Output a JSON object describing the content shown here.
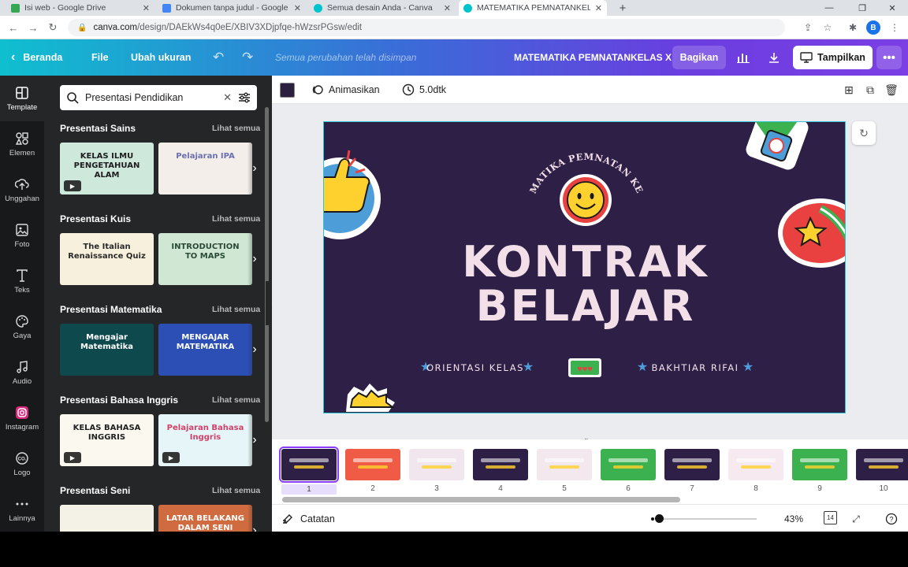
{
  "browser": {
    "tabs": [
      {
        "title": "Isi web - Google Drive",
        "color": "#34a853"
      },
      {
        "title": "Dokumen tanpa judul - Google D",
        "color": "#4285f4"
      },
      {
        "title": "Semua desain Anda - Canva",
        "color": "#00c4cc"
      },
      {
        "title": "MATEMATIKA PEMNATANKELAS",
        "color": "#00c4cc"
      }
    ],
    "url_host": "canva.com",
    "url_path": "/design/DAEkWs4q0eE/XBIV3XDjpfqe-hWzsrPGsw/edit",
    "profile_initial": "B"
  },
  "header": {
    "home": "Beranda",
    "file": "File",
    "resize": "Ubah ukuran",
    "saved_status": "Semua perubahan telah disimpan",
    "doc_title": "MATEMATIKA PEMNATANKELAS X",
    "share": "Bagikan",
    "present": "Tampilkan"
  },
  "rail": [
    {
      "label": "Template",
      "icon": "template-icon"
    },
    {
      "label": "Elemen",
      "icon": "elements-icon"
    },
    {
      "label": "Unggahan",
      "icon": "upload-icon"
    },
    {
      "label": "Foto",
      "icon": "photo-icon"
    },
    {
      "label": "Teks",
      "icon": "text-icon"
    },
    {
      "label": "Gaya",
      "icon": "palette-icon"
    },
    {
      "label": "Audio",
      "icon": "music-icon"
    },
    {
      "label": "Instagram",
      "icon": "instagram-icon"
    },
    {
      "label": "Logo",
      "icon": "logo-icon"
    },
    {
      "label": "Lainnya",
      "icon": "more-icon"
    }
  ],
  "panel": {
    "search_value": "Presentasi Pendidikan",
    "see_all": "Lihat semua",
    "sections": [
      {
        "title": "Presentasi Sains",
        "thumbs": [
          {
            "text": "KELAS ILMU PENGETAHUAN ALAM",
            "bg": "#cfe8dc",
            "fg": "#1d1d1d",
            "video": true
          },
          {
            "text": "Pelajaran IPA",
            "bg": "#f3eeea",
            "fg": "#6a6fb0",
            "video": false
          }
        ]
      },
      {
        "title": "Presentasi Kuis",
        "thumbs": [
          {
            "text": "The Italian Renaissance Quiz",
            "bg": "#f6f0dc",
            "fg": "#2a2a2a",
            "video": false
          },
          {
            "text": "INTRODUCTION TO MAPS",
            "bg": "#cfe7d3",
            "fg": "#2c4a39",
            "video": false
          }
        ]
      },
      {
        "title": "Presentasi Matematika",
        "thumbs": [
          {
            "text": "Mengajar Matematika",
            "bg": "#0e4a4d",
            "fg": "#ffffff",
            "video": false
          },
          {
            "text": "MENGAJAR MATEMATIKA",
            "bg": "#2c4fb5",
            "fg": "#ffffff",
            "video": false
          }
        ]
      },
      {
        "title": "Presentasi Bahasa Inggris",
        "thumbs": [
          {
            "text": "KELAS BAHASA INGGRIS",
            "bg": "#fbf8f0",
            "fg": "#222222",
            "video": true
          },
          {
            "text": "Pelajaran Bahasa Inggris",
            "bg": "#e6f5f7",
            "fg": "#d2416a",
            "video": true
          }
        ]
      },
      {
        "title": "Presentasi Seni",
        "thumbs": [
          {
            "text": "",
            "bg": "#f4f1e6",
            "fg": "#333333",
            "video": false
          },
          {
            "text": "LATAR BELAKANG DALAM SENI PAHAT",
            "bg": "#cf6b3f",
            "fg": "#ffffff",
            "video": false
          }
        ]
      }
    ]
  },
  "editor": {
    "color_swatch": "#2b2040",
    "animate": "Animasikan",
    "duration": "5.0dtk"
  },
  "slide": {
    "arc_title": "MATEMATIKA PEMNATAN KELAS X",
    "title_line1": "KONTRAK",
    "title_line2": "BELAJAR",
    "left_caption": "ORIENTASI KELAS",
    "right_caption": "BAKHTIAR RIFAI",
    "bg": "#2e1f46",
    "title_color": "#f2dfe8"
  },
  "pages": [
    {
      "num": "1",
      "bg": "#2e1f46"
    },
    {
      "num": "2",
      "bg": "#ef5b45"
    },
    {
      "num": "3",
      "bg": "#f2e6ee"
    },
    {
      "num": "4",
      "bg": "#2e1f46"
    },
    {
      "num": "5",
      "bg": "#f4e8ef"
    },
    {
      "num": "6",
      "bg": "#3bb14f"
    },
    {
      "num": "7",
      "bg": "#2e1f46"
    },
    {
      "num": "8",
      "bg": "#f6e9f0"
    },
    {
      "num": "9",
      "bg": "#3bb14f"
    },
    {
      "num": "10",
      "bg": "#2e1f46"
    }
  ],
  "footer": {
    "notes": "Catatan",
    "zoom": "43%",
    "page_count": "14"
  }
}
